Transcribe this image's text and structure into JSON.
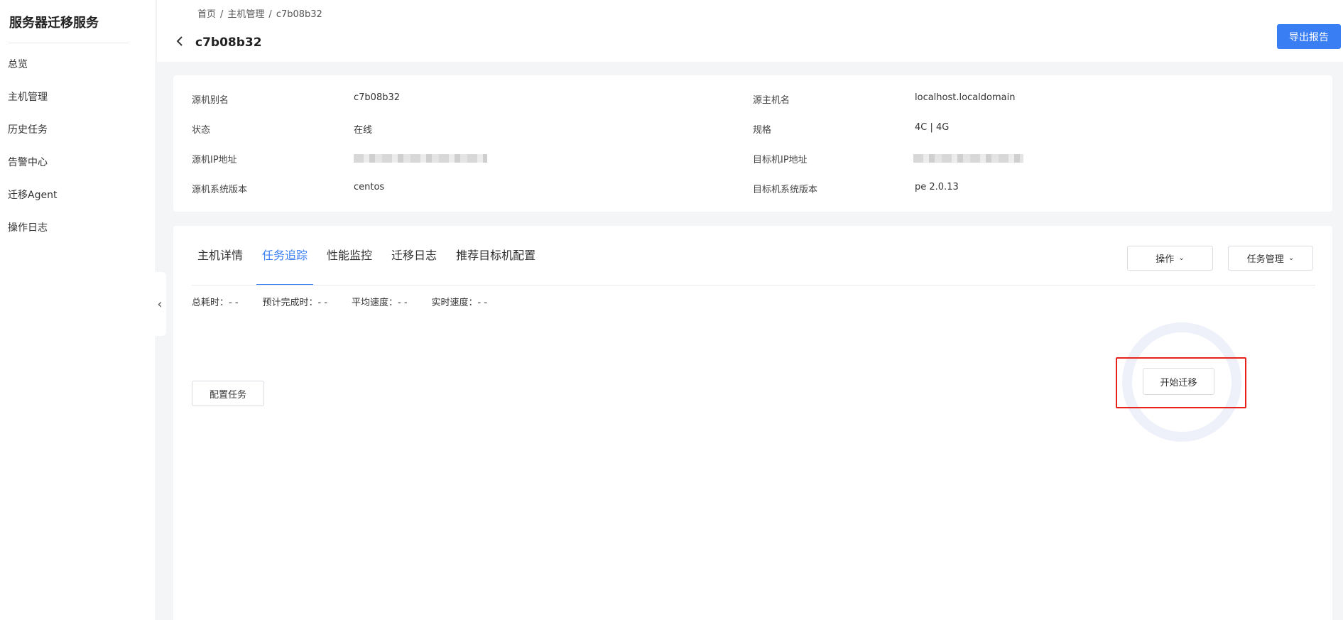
{
  "sidebar": {
    "title": "服务器迁移服务",
    "items": [
      {
        "label": "总览"
      },
      {
        "label": "主机管理"
      },
      {
        "label": "历史任务"
      },
      {
        "label": "告警中心"
      },
      {
        "label": "迁移Agent"
      },
      {
        "label": "操作日志"
      }
    ],
    "collapse_icon": "chevron-left-icon"
  },
  "header": {
    "breadcrumb": [
      "首页",
      "主机管理",
      "c7b08b32"
    ],
    "breadcrumb_separator": "/",
    "title": "c7b08b32",
    "back_icon": "chevron-left-icon",
    "export_label": "导出报告",
    "accent_color": "#3a7ef3"
  },
  "info": {
    "source_alias_label": "源机别名",
    "source_alias_value": "c7b08b32",
    "source_hostname_label": "源主机名",
    "source_hostname_value": "localhost.localdomain",
    "status_label": "状态",
    "status_value": "在线",
    "spec_label": "规格",
    "spec_value": "4C | 4G",
    "source_ip_label": "源机IP地址",
    "target_ip_label": "目标机IP地址",
    "source_os_label": "源机系统版本",
    "source_os_value": "centos",
    "target_os_label": "目标机系统版本",
    "target_os_value": "pe 2.0.13"
  },
  "tabs": [
    {
      "label": "主机详情",
      "active": false
    },
    {
      "label": "任务追踪",
      "active": true
    },
    {
      "label": "性能监控",
      "active": false
    },
    {
      "label": "迁移日志",
      "active": false
    },
    {
      "label": "推荐目标机配置",
      "active": false
    }
  ],
  "actions": {
    "operate_label": "操作",
    "task_manage_label": "任务管理"
  },
  "stats": [
    {
      "label": "总耗时：- -"
    },
    {
      "label": "预计完成时：- -"
    },
    {
      "label": "平均速度：- -"
    },
    {
      "label": "实时速度：- -"
    }
  ],
  "task": {
    "config_label": "配置任务",
    "start_label": "开始迁移",
    "ring_color": "#eef1fa",
    "highlight_color": "#e8221a"
  }
}
